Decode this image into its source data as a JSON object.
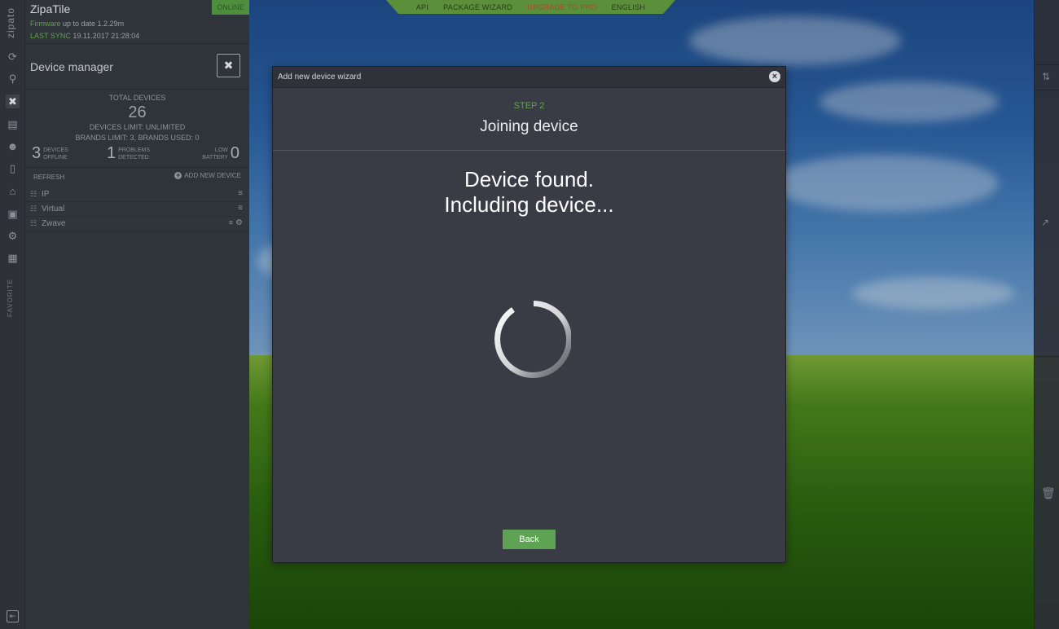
{
  "app": {
    "brand": "zipato",
    "tile_name": "ZipaTile",
    "status_badge": "ONLINE",
    "firmware_label": "Firmware",
    "firmware_text": "up to date 1.2.29m",
    "last_sync_label": "LAST SYNC",
    "last_sync_value": "19.11.2017 21:28:04",
    "favorites_label": "FAVORITE"
  },
  "device_manager": {
    "title": "Device manager",
    "total_label": "TOTAL DEVICES",
    "total_value": "26",
    "devices_limit": "DEVICES LIMIT: UNLIMITED",
    "brands_line": "BRANDS LIMIT: 3, BRANDS USED: 0",
    "offline_count": "3",
    "offline_label_1": "DEVICES",
    "offline_label_2": "OFFLINE",
    "problems_count": "1",
    "problems_label_1": "PROBLEMS",
    "problems_label_2": "DETECTED",
    "battery_count": "0",
    "battery_label_1": "LOW",
    "battery_label_2": "BATTERY",
    "refresh_label": "REFRESH",
    "add_device_label": "ADD NEW DEVICE",
    "devices": [
      {
        "name": "IP"
      },
      {
        "name": "Virtual"
      },
      {
        "name": "Zwave"
      }
    ]
  },
  "topnav": {
    "items": [
      "API",
      "PACKAGE WIZARD",
      "UPGRADE TO PRO",
      "ENGLISH"
    ]
  },
  "modal": {
    "title": "Add new device wizard",
    "step_label": "STEP 2",
    "step_title": "Joining device",
    "message_line1": "Device found.",
    "message_line2": "Including device...",
    "back_label": "Back"
  },
  "colors": {
    "accent_green": "#5fa34b",
    "upgrade_red": "#b5432a",
    "modal_bg": "#3a3c45",
    "panel_bg": "#2f333a"
  },
  "icons": {
    "rail": [
      "refresh-icon",
      "search-icon",
      "device-manager-icon",
      "scenes-icon",
      "users-icon",
      "phone-icon",
      "home-icon",
      "briefcase-icon",
      "settings-icon",
      "save-icon"
    ],
    "logout": "logout-icon",
    "close": "close-icon",
    "sort": "sort-icon",
    "external": "external-link-icon",
    "trash": "trash-icon"
  }
}
